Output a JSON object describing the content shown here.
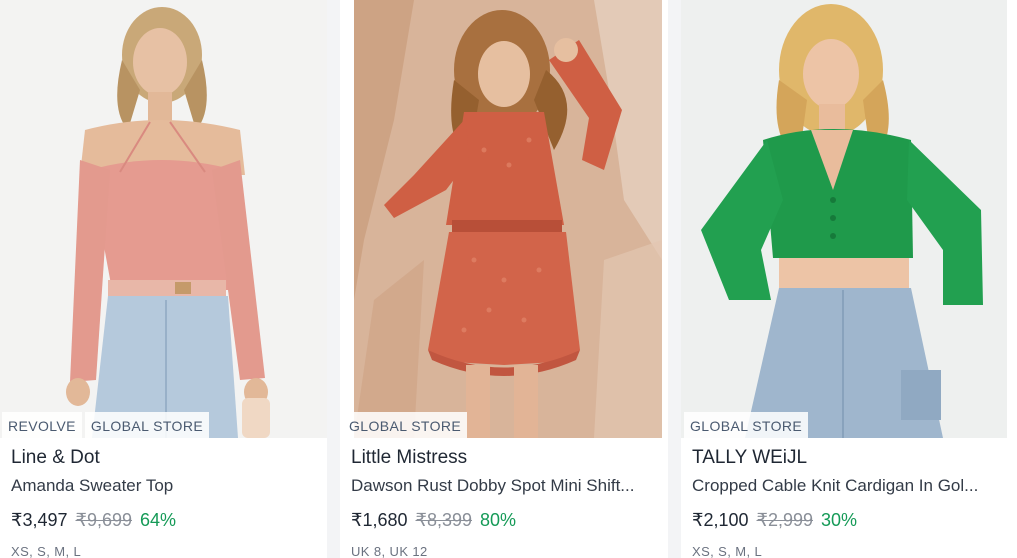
{
  "products": [
    {
      "image_alt": "product-photo",
      "tags": [
        "REVOLVE",
        "GLOBAL STORE"
      ],
      "brand": "Line & Dot",
      "title": "Amanda Sweater Top",
      "price": "₹3,497",
      "mrp": "₹9,699",
      "discount": "64%",
      "sizes": "XS, S, M, L"
    },
    {
      "image_alt": "product-photo",
      "tags": [
        "GLOBAL STORE"
      ],
      "brand": "Little Mistress",
      "title": "Dawson Rust Dobby Spot Mini Shift...",
      "price": "₹1,680",
      "mrp": "₹8,399",
      "discount": "80%",
      "sizes": "UK 8, UK 12"
    },
    {
      "image_alt": "product-photo",
      "tags": [
        "GLOBAL STORE"
      ],
      "brand": "TALLY WEiJL",
      "title": "Cropped Cable Knit Cardigan In Gol...",
      "price": "₹2,100",
      "mrp": "₹2,999",
      "discount": "30%",
      "sizes": "XS, S, M, L"
    }
  ],
  "colors": {
    "discount": "#159a57",
    "tag_text": "#4a5a70",
    "brand_text": "#1f2733"
  }
}
